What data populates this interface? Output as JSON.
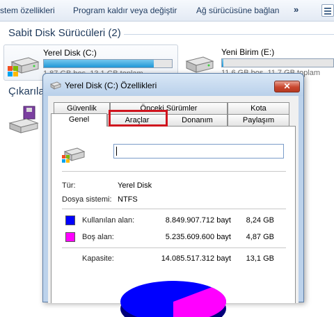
{
  "toolbar": {
    "system_properties": "stem özellikleri",
    "uninstall": "Program kaldır veya değiştir",
    "map_network": "Ağ sürücüsüne bağlan",
    "more": "»"
  },
  "hard_disks": {
    "title": "Sabit Disk Sürücüleri (2)",
    "drives": [
      {
        "name": "Yerel Disk (C:)",
        "space": "1,87 GB boş, 13,1 GB toplam",
        "used_fraction": 0.86
      },
      {
        "name": "Yeni Birim (E:)",
        "space": "11,6 GB boş, 11,7 GB toplam",
        "used_fraction": 0.01
      }
    ]
  },
  "removable": {
    "title": "Çıkarıla"
  },
  "dialog": {
    "title": "Yerel Disk (C:) Özellikleri",
    "close": "✕",
    "tabs": {
      "security": "Güvenlik",
      "previous_versions": "Önceki Sürümler",
      "quota": "Kota",
      "general": "Genel",
      "tools": "Araçlar",
      "hardware": "Donanım",
      "sharing": "Paylaşım"
    },
    "name_value": "",
    "type_label": "Tür:",
    "type_value": "Yerel Disk",
    "fs_label": "Dosya sistemi:",
    "fs_value": "NTFS",
    "used_label": "Kullanılan alan:",
    "used_bytes": "8.849.907.712 bayt",
    "used_gb": "8,24 GB",
    "free_label": "Boş alan:",
    "free_bytes": "5.235.609.600 bayt",
    "free_gb": "4,87 GB",
    "capacity_label": "Kapasite:",
    "capacity_bytes": "14.085.517.312 bayt",
    "capacity_gb": "13,1 GB",
    "colors": {
      "used": "#0000ff",
      "free": "#ff00ff"
    }
  }
}
